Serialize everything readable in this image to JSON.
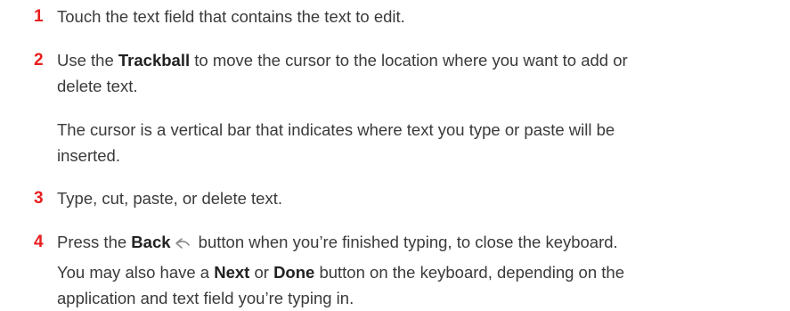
{
  "steps": [
    {
      "number": "1",
      "text": "Touch the text field that contains the text to edit."
    },
    {
      "number": "2",
      "pre": "Use the ",
      "bold": "Trackball",
      "post": " to move the cursor to the location where you want to add or",
      "line2": "delete text."
    },
    {
      "note1_line1": "The cursor is a vertical bar that indicates where text you type or paste will be",
      "note1_line2": "inserted."
    },
    {
      "number": "3",
      "text": "Type, cut, paste, or delete text."
    },
    {
      "number": "4",
      "pre": "Press the ",
      "bold": "Back",
      "post": " button when you’re finished typing, to close the keyboard."
    },
    {
      "note_pre": "You may also have a ",
      "bold1": "Next",
      "mid": " or ",
      "bold2": "Done",
      "note_post": " button on the keyboard, depending on the",
      "line2": "application and text field you’re typing in."
    }
  ],
  "icons": {
    "back": "back-arrow-icon"
  },
  "colors": {
    "step_number": "#e81e1e",
    "text": "#3a3a3a"
  }
}
